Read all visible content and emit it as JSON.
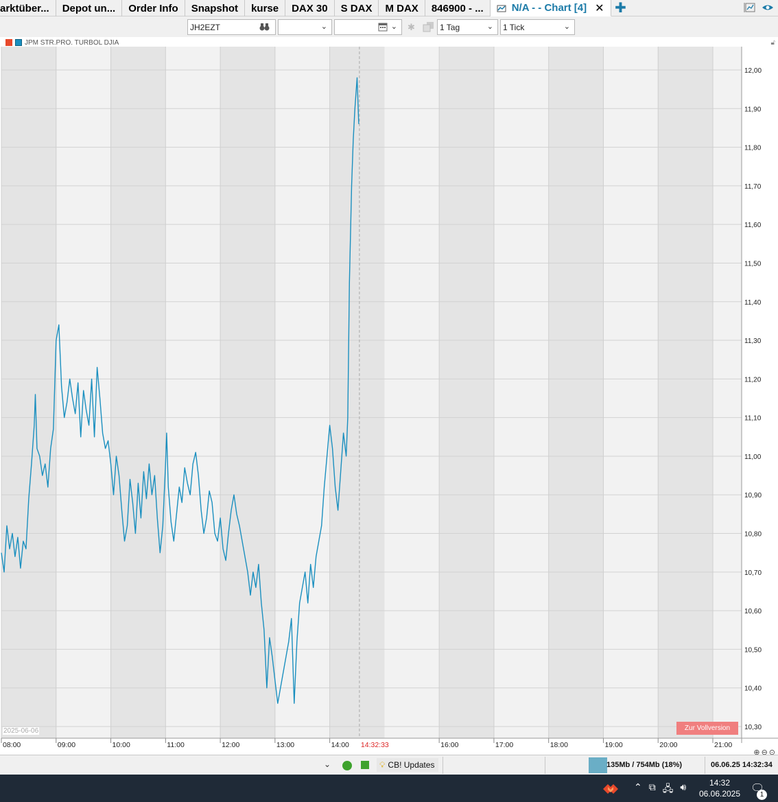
{
  "tabs": [
    {
      "label": "arktüber..."
    },
    {
      "label": "Depot un..."
    },
    {
      "label": "Order Info"
    },
    {
      "label": "Snapshot"
    },
    {
      "label": "kurse"
    },
    {
      "label": "DAX 30"
    },
    {
      "label": "S DAX"
    },
    {
      "label": "M DAX"
    },
    {
      "label": "846900 - ..."
    },
    {
      "label": "N/A -  - Chart [4]",
      "active": true
    }
  ],
  "toolbar": {
    "symbol_value": "JH2EZT",
    "select1_value": "",
    "date_value": "",
    "period_value": "1 Tag",
    "interval_value": "1 Tick"
  },
  "legend": {
    "series_name": "JPM STR.PRO. TURBOL DJIA",
    "color": "#1a8fbf"
  },
  "date_stamp": "2025-06-06",
  "full_version_label": "Zur Vollversion",
  "current_time_label": "14:32:33",
  "chart_data": {
    "type": "line",
    "x_unit": "time of day (hours)",
    "x_range": [
      "08:00",
      "21:00"
    ],
    "x_ticks": [
      "08:00",
      "09:00",
      "10:00",
      "11:00",
      "12:00",
      "13:00",
      "14:00",
      "16:00",
      "17:00",
      "18:00",
      "19:00",
      "20:00",
      "21:00"
    ],
    "y_ticks": [
      "12,00",
      "11,90",
      "11,80",
      "11,70",
      "11,60",
      "11,50",
      "11,40",
      "11,30",
      "11,20",
      "11,10",
      "11,00",
      "10,90",
      "10,80",
      "10,70",
      "10,60",
      "10,50",
      "10,40",
      "10,30"
    ],
    "ylim": [
      10.25,
      12.03
    ],
    "grid": true,
    "alternating_hour_bands": true,
    "current_time_marker": "14:32:33",
    "series": [
      {
        "name": "JPM STR.PRO. TURBOL DJIA",
        "color": "#1a8fbf",
        "points": [
          [
            8.0,
            10.75
          ],
          [
            8.05,
            10.7
          ],
          [
            8.1,
            10.82
          ],
          [
            8.15,
            10.76
          ],
          [
            8.2,
            10.8
          ],
          [
            8.25,
            10.74
          ],
          [
            8.3,
            10.79
          ],
          [
            8.35,
            10.71
          ],
          [
            8.4,
            10.78
          ],
          [
            8.45,
            10.76
          ],
          [
            8.5,
            10.89
          ],
          [
            8.55,
            10.98
          ],
          [
            8.6,
            11.08
          ],
          [
            8.62,
            11.16
          ],
          [
            8.65,
            11.02
          ],
          [
            8.7,
            11.0
          ],
          [
            8.75,
            10.95
          ],
          [
            8.8,
            10.98
          ],
          [
            8.85,
            10.92
          ],
          [
            8.9,
            11.02
          ],
          [
            8.95,
            11.07
          ],
          [
            9.0,
            11.3
          ],
          [
            9.05,
            11.34
          ],
          [
            9.1,
            11.18
          ],
          [
            9.15,
            11.1
          ],
          [
            9.2,
            11.14
          ],
          [
            9.25,
            11.2
          ],
          [
            9.3,
            11.15
          ],
          [
            9.35,
            11.11
          ],
          [
            9.4,
            11.19
          ],
          [
            9.45,
            11.05
          ],
          [
            9.5,
            11.17
          ],
          [
            9.55,
            11.12
          ],
          [
            9.6,
            11.08
          ],
          [
            9.65,
            11.2
          ],
          [
            9.7,
            11.05
          ],
          [
            9.75,
            11.23
          ],
          [
            9.8,
            11.15
          ],
          [
            9.85,
            11.06
          ],
          [
            9.9,
            11.02
          ],
          [
            9.95,
            11.04
          ],
          [
            10.0,
            10.98
          ],
          [
            10.05,
            10.9
          ],
          [
            10.1,
            11.0
          ],
          [
            10.15,
            10.95
          ],
          [
            10.2,
            10.86
          ],
          [
            10.25,
            10.78
          ],
          [
            10.3,
            10.82
          ],
          [
            10.35,
            10.94
          ],
          [
            10.4,
            10.88
          ],
          [
            10.45,
            10.8
          ],
          [
            10.5,
            10.93
          ],
          [
            10.55,
            10.84
          ],
          [
            10.6,
            10.96
          ],
          [
            10.65,
            10.89
          ],
          [
            10.7,
            10.98
          ],
          [
            10.75,
            10.9
          ],
          [
            10.8,
            10.95
          ],
          [
            10.85,
            10.84
          ],
          [
            10.9,
            10.75
          ],
          [
            10.95,
            10.82
          ],
          [
            11.0,
            10.98
          ],
          [
            11.02,
            11.06
          ],
          [
            11.05,
            10.92
          ],
          [
            11.1,
            10.83
          ],
          [
            11.15,
            10.78
          ],
          [
            11.2,
            10.85
          ],
          [
            11.25,
            10.92
          ],
          [
            11.3,
            10.88
          ],
          [
            11.35,
            10.97
          ],
          [
            11.4,
            10.93
          ],
          [
            11.45,
            10.9
          ],
          [
            11.5,
            10.98
          ],
          [
            11.55,
            11.01
          ],
          [
            11.6,
            10.95
          ],
          [
            11.65,
            10.86
          ],
          [
            11.7,
            10.8
          ],
          [
            11.75,
            10.84
          ],
          [
            11.8,
            10.91
          ],
          [
            11.85,
            10.88
          ],
          [
            11.9,
            10.8
          ],
          [
            11.95,
            10.78
          ],
          [
            12.0,
            10.84
          ],
          [
            12.05,
            10.76
          ],
          [
            12.1,
            10.73
          ],
          [
            12.15,
            10.8
          ],
          [
            12.2,
            10.86
          ],
          [
            12.25,
            10.9
          ],
          [
            12.3,
            10.85
          ],
          [
            12.35,
            10.82
          ],
          [
            12.4,
            10.78
          ],
          [
            12.45,
            10.74
          ],
          [
            12.5,
            10.7
          ],
          [
            12.55,
            10.64
          ],
          [
            12.6,
            10.7
          ],
          [
            12.65,
            10.66
          ],
          [
            12.7,
            10.72
          ],
          [
            12.75,
            10.62
          ],
          [
            12.8,
            10.55
          ],
          [
            12.85,
            10.4
          ],
          [
            12.9,
            10.53
          ],
          [
            12.95,
            10.48
          ],
          [
            13.0,
            10.42
          ],
          [
            13.05,
            10.36
          ],
          [
            13.1,
            10.4
          ],
          [
            13.15,
            10.44
          ],
          [
            13.2,
            10.48
          ],
          [
            13.25,
            10.52
          ],
          [
            13.3,
            10.58
          ],
          [
            13.35,
            10.36
          ],
          [
            13.4,
            10.52
          ],
          [
            13.45,
            10.62
          ],
          [
            13.5,
            10.66
          ],
          [
            13.55,
            10.7
          ],
          [
            13.6,
            10.62
          ],
          [
            13.65,
            10.72
          ],
          [
            13.7,
            10.66
          ],
          [
            13.75,
            10.74
          ],
          [
            13.8,
            10.78
          ],
          [
            13.85,
            10.82
          ],
          [
            13.9,
            10.92
          ],
          [
            13.95,
            11.0
          ],
          [
            14.0,
            11.08
          ],
          [
            14.05,
            11.02
          ],
          [
            14.1,
            10.92
          ],
          [
            14.15,
            10.86
          ],
          [
            14.2,
            10.96
          ],
          [
            14.25,
            11.06
          ],
          [
            14.3,
            11.0
          ],
          [
            14.33,
            11.1
          ],
          [
            14.36,
            11.45
          ],
          [
            14.4,
            11.7
          ],
          [
            14.43,
            11.82
          ],
          [
            14.46,
            11.9
          ],
          [
            14.5,
            11.98
          ],
          [
            14.53,
            11.86
          ]
        ]
      }
    ]
  },
  "status": {
    "updates_label": "CB! Updates",
    "memory": "135Mb / 754Mb (18%)",
    "datetime": "06.06.25  14:32:34"
  },
  "taskbar": {
    "time": "14:32",
    "date": "06.06.2025",
    "notification_count": "1"
  }
}
